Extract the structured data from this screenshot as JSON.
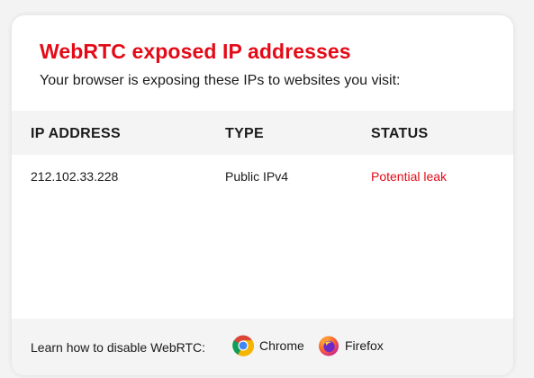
{
  "header": {
    "title": "WebRTC exposed IP addresses",
    "subtitle": "Your browser is exposing these IPs to websites you visit:"
  },
  "table": {
    "columns": [
      "IP ADDRESS",
      "TYPE",
      "STATUS"
    ],
    "rows": [
      {
        "ip": "212.102.33.228",
        "type": "Public IPv4",
        "status": "Potential leak"
      }
    ]
  },
  "footer": {
    "text": "Learn how to disable WebRTC:",
    "links": [
      {
        "label": "Chrome",
        "icon": "chrome-icon"
      },
      {
        "label": "Firefox",
        "icon": "firefox-icon"
      }
    ]
  },
  "colors": {
    "accent": "#e30b17",
    "text": "#1b1b1b",
    "panel": "#f4f4f4"
  }
}
